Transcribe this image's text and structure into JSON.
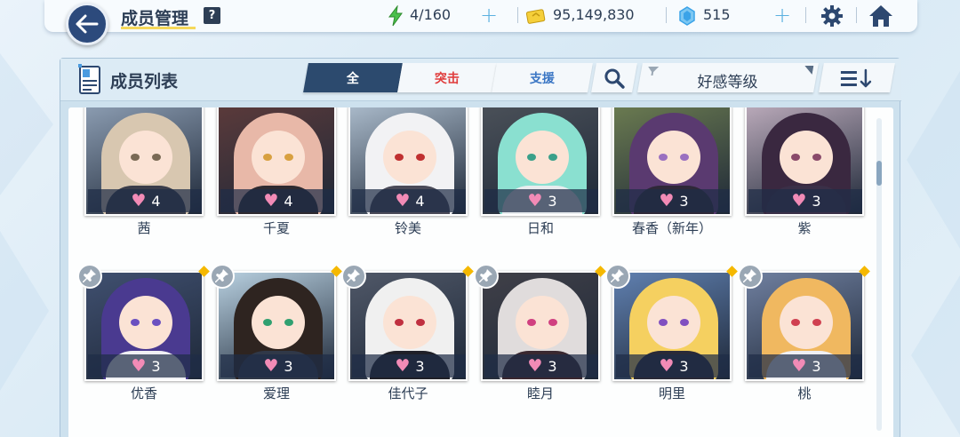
{
  "header": {
    "title": "成员管理",
    "help_label": "?",
    "ap": "4/160",
    "credits": "95,149,830",
    "gems": "515",
    "plus": "+"
  },
  "panel": {
    "title": "成员列表",
    "tabs": [
      {
        "label": "全",
        "active": true
      },
      {
        "label": "突击",
        "color": "#e03c3c"
      },
      {
        "label": "支援",
        "color": "#3a76c4"
      }
    ],
    "sort_label": "好感等级"
  },
  "members": [
    {
      "name": "茜",
      "affinity": "4"
    },
    {
      "name": "千夏",
      "affinity": "4"
    },
    {
      "name": "铃美",
      "affinity": "4"
    },
    {
      "name": "日和",
      "affinity": "3"
    },
    {
      "name": "春香（新年）",
      "affinity": "3"
    },
    {
      "name": "紫",
      "affinity": "3"
    },
    {
      "name": "优香",
      "affinity": "3"
    },
    {
      "name": "爱理",
      "affinity": "3"
    },
    {
      "name": "佳代子",
      "affinity": "3"
    },
    {
      "name": "睦月",
      "affinity": "3"
    },
    {
      "name": "明里",
      "affinity": "3"
    },
    {
      "name": "桃",
      "affinity": "3"
    }
  ],
  "colors": {
    "accent": "#2c4a6e",
    "heart": "#f28bb6",
    "ap_icon": "#4bc04b",
    "gem_icon": "#3aa3e8",
    "new_dot": "#f5b800"
  }
}
